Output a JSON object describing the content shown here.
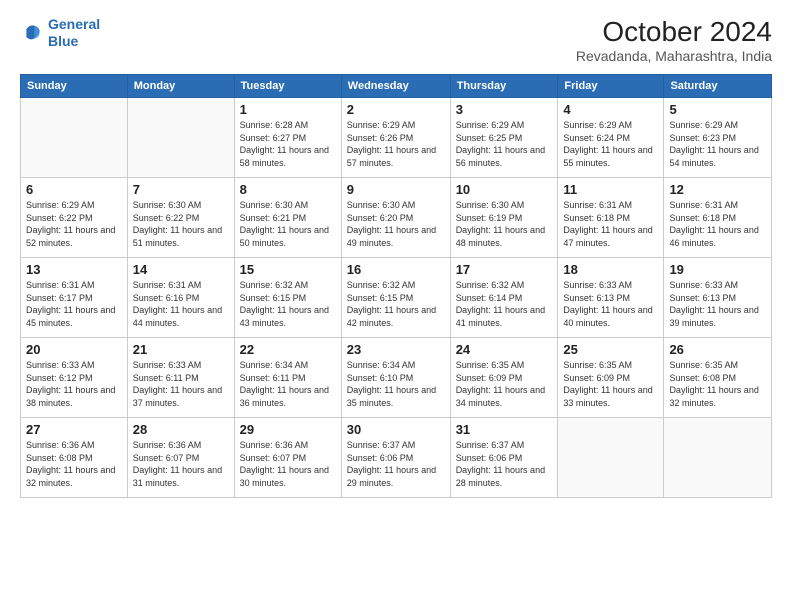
{
  "header": {
    "logo_line1": "General",
    "logo_line2": "Blue",
    "title": "October 2024",
    "subtitle": "Revadanda, Maharashtra, India"
  },
  "calendar": {
    "days_of_week": [
      "Sunday",
      "Monday",
      "Tuesday",
      "Wednesday",
      "Thursday",
      "Friday",
      "Saturday"
    ],
    "weeks": [
      [
        {
          "day": "",
          "info": ""
        },
        {
          "day": "",
          "info": ""
        },
        {
          "day": "1",
          "info": "Sunrise: 6:28 AM\nSunset: 6:27 PM\nDaylight: 11 hours and 58 minutes."
        },
        {
          "day": "2",
          "info": "Sunrise: 6:29 AM\nSunset: 6:26 PM\nDaylight: 11 hours and 57 minutes."
        },
        {
          "day": "3",
          "info": "Sunrise: 6:29 AM\nSunset: 6:25 PM\nDaylight: 11 hours and 56 minutes."
        },
        {
          "day": "4",
          "info": "Sunrise: 6:29 AM\nSunset: 6:24 PM\nDaylight: 11 hours and 55 minutes."
        },
        {
          "day": "5",
          "info": "Sunrise: 6:29 AM\nSunset: 6:23 PM\nDaylight: 11 hours and 54 minutes."
        }
      ],
      [
        {
          "day": "6",
          "info": "Sunrise: 6:29 AM\nSunset: 6:22 PM\nDaylight: 11 hours and 52 minutes."
        },
        {
          "day": "7",
          "info": "Sunrise: 6:30 AM\nSunset: 6:22 PM\nDaylight: 11 hours and 51 minutes."
        },
        {
          "day": "8",
          "info": "Sunrise: 6:30 AM\nSunset: 6:21 PM\nDaylight: 11 hours and 50 minutes."
        },
        {
          "day": "9",
          "info": "Sunrise: 6:30 AM\nSunset: 6:20 PM\nDaylight: 11 hours and 49 minutes."
        },
        {
          "day": "10",
          "info": "Sunrise: 6:30 AM\nSunset: 6:19 PM\nDaylight: 11 hours and 48 minutes."
        },
        {
          "day": "11",
          "info": "Sunrise: 6:31 AM\nSunset: 6:18 PM\nDaylight: 11 hours and 47 minutes."
        },
        {
          "day": "12",
          "info": "Sunrise: 6:31 AM\nSunset: 6:18 PM\nDaylight: 11 hours and 46 minutes."
        }
      ],
      [
        {
          "day": "13",
          "info": "Sunrise: 6:31 AM\nSunset: 6:17 PM\nDaylight: 11 hours and 45 minutes."
        },
        {
          "day": "14",
          "info": "Sunrise: 6:31 AM\nSunset: 6:16 PM\nDaylight: 11 hours and 44 minutes."
        },
        {
          "day": "15",
          "info": "Sunrise: 6:32 AM\nSunset: 6:15 PM\nDaylight: 11 hours and 43 minutes."
        },
        {
          "day": "16",
          "info": "Sunrise: 6:32 AM\nSunset: 6:15 PM\nDaylight: 11 hours and 42 minutes."
        },
        {
          "day": "17",
          "info": "Sunrise: 6:32 AM\nSunset: 6:14 PM\nDaylight: 11 hours and 41 minutes."
        },
        {
          "day": "18",
          "info": "Sunrise: 6:33 AM\nSunset: 6:13 PM\nDaylight: 11 hours and 40 minutes."
        },
        {
          "day": "19",
          "info": "Sunrise: 6:33 AM\nSunset: 6:13 PM\nDaylight: 11 hours and 39 minutes."
        }
      ],
      [
        {
          "day": "20",
          "info": "Sunrise: 6:33 AM\nSunset: 6:12 PM\nDaylight: 11 hours and 38 minutes."
        },
        {
          "day": "21",
          "info": "Sunrise: 6:33 AM\nSunset: 6:11 PM\nDaylight: 11 hours and 37 minutes."
        },
        {
          "day": "22",
          "info": "Sunrise: 6:34 AM\nSunset: 6:11 PM\nDaylight: 11 hours and 36 minutes."
        },
        {
          "day": "23",
          "info": "Sunrise: 6:34 AM\nSunset: 6:10 PM\nDaylight: 11 hours and 35 minutes."
        },
        {
          "day": "24",
          "info": "Sunrise: 6:35 AM\nSunset: 6:09 PM\nDaylight: 11 hours and 34 minutes."
        },
        {
          "day": "25",
          "info": "Sunrise: 6:35 AM\nSunset: 6:09 PM\nDaylight: 11 hours and 33 minutes."
        },
        {
          "day": "26",
          "info": "Sunrise: 6:35 AM\nSunset: 6:08 PM\nDaylight: 11 hours and 32 minutes."
        }
      ],
      [
        {
          "day": "27",
          "info": "Sunrise: 6:36 AM\nSunset: 6:08 PM\nDaylight: 11 hours and 32 minutes."
        },
        {
          "day": "28",
          "info": "Sunrise: 6:36 AM\nSunset: 6:07 PM\nDaylight: 11 hours and 31 minutes."
        },
        {
          "day": "29",
          "info": "Sunrise: 6:36 AM\nSunset: 6:07 PM\nDaylight: 11 hours and 30 minutes."
        },
        {
          "day": "30",
          "info": "Sunrise: 6:37 AM\nSunset: 6:06 PM\nDaylight: 11 hours and 29 minutes."
        },
        {
          "day": "31",
          "info": "Sunrise: 6:37 AM\nSunset: 6:06 PM\nDaylight: 11 hours and 28 minutes."
        },
        {
          "day": "",
          "info": ""
        },
        {
          "day": "",
          "info": ""
        }
      ]
    ]
  }
}
